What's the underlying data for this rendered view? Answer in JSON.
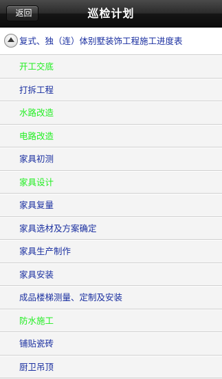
{
  "nav": {
    "back_label": "返回",
    "title": "巡检计划"
  },
  "group": {
    "title": "复式、独（连）体别墅装饰工程施工进度表",
    "icon": "collapse-up-icon"
  },
  "colors": {
    "completed": "#22ee22",
    "pending": "#1a2fa0"
  },
  "items": [
    {
      "label": "开工交底",
      "status": "completed"
    },
    {
      "label": "打拆工程",
      "status": "pending"
    },
    {
      "label": "水路改造",
      "status": "completed"
    },
    {
      "label": "电路改造",
      "status": "completed"
    },
    {
      "label": "家具初测",
      "status": "pending"
    },
    {
      "label": "家具设计",
      "status": "completed"
    },
    {
      "label": "家具复量",
      "status": "pending"
    },
    {
      "label": "家具选材及方案确定",
      "status": "pending"
    },
    {
      "label": "家具生产制作",
      "status": "pending"
    },
    {
      "label": "家具安装",
      "status": "pending"
    },
    {
      "label": "成品楼梯测量、定制及安装",
      "status": "pending"
    },
    {
      "label": "防水施工",
      "status": "completed"
    },
    {
      "label": "铺贴瓷砖",
      "status": "pending"
    },
    {
      "label": "厨卫吊顶",
      "status": "pending"
    }
  ]
}
